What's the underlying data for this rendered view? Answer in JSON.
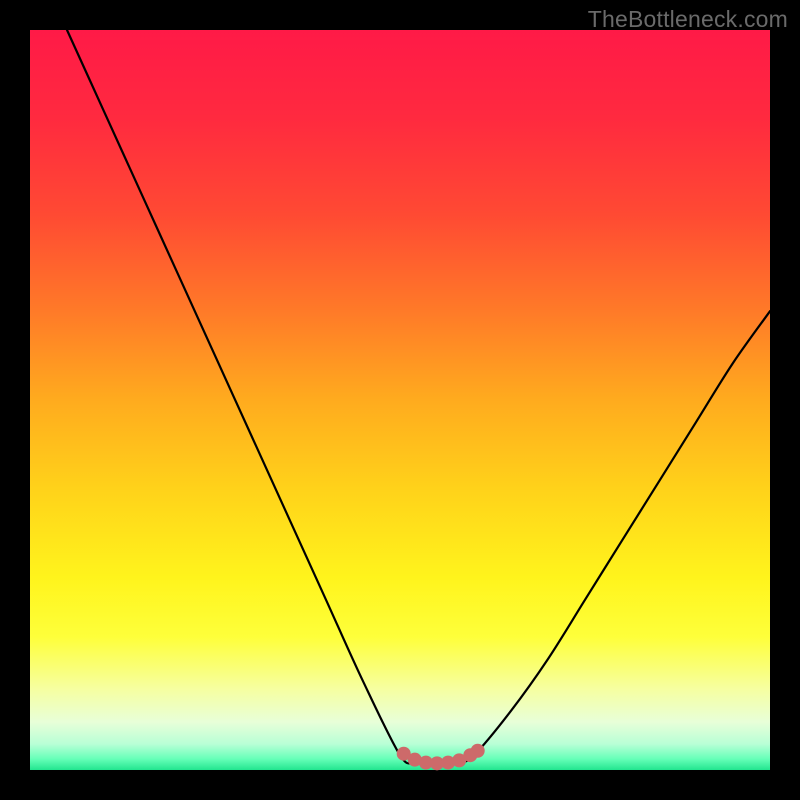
{
  "watermark": "TheBottleneck.com",
  "colors": {
    "frame": "#000000",
    "curve_stroke": "#000000",
    "marker_fill": "#cd6a6a",
    "gradient_stops": [
      {
        "offset": 0.0,
        "color": "#ff1a47"
      },
      {
        "offset": 0.12,
        "color": "#ff2a3f"
      },
      {
        "offset": 0.25,
        "color": "#ff4a33"
      },
      {
        "offset": 0.38,
        "color": "#ff7a28"
      },
      {
        "offset": 0.5,
        "color": "#ffab1e"
      },
      {
        "offset": 0.62,
        "color": "#ffd21a"
      },
      {
        "offset": 0.74,
        "color": "#fff41c"
      },
      {
        "offset": 0.82,
        "color": "#feff3a"
      },
      {
        "offset": 0.89,
        "color": "#f6ffa0"
      },
      {
        "offset": 0.935,
        "color": "#e8ffd8"
      },
      {
        "offset": 0.965,
        "color": "#b8ffd6"
      },
      {
        "offset": 0.985,
        "color": "#66ffb8"
      },
      {
        "offset": 1.0,
        "color": "#22e58f"
      }
    ]
  },
  "chart_data": {
    "type": "line",
    "title": "",
    "xlabel": "",
    "ylabel": "",
    "xlim": [
      0,
      100
    ],
    "ylim": [
      0,
      100
    ],
    "series": [
      {
        "name": "bottleneck-curve",
        "x": [
          5,
          10,
          15,
          20,
          25,
          30,
          35,
          40,
          45,
          50,
          52,
          54,
          56,
          58,
          60,
          65,
          70,
          75,
          80,
          85,
          90,
          95,
          100
        ],
        "y": [
          100,
          89,
          78,
          67,
          56,
          45,
          34,
          23,
          12,
          2,
          1,
          0.8,
          0.8,
          1,
          2,
          8,
          15,
          23,
          31,
          39,
          47,
          55,
          62
        ]
      }
    ],
    "markers": {
      "name": "bottom-markers",
      "points": [
        {
          "x": 50.5,
          "y": 2.2
        },
        {
          "x": 52.0,
          "y": 1.4
        },
        {
          "x": 53.5,
          "y": 1.0
        },
        {
          "x": 55.0,
          "y": 0.9
        },
        {
          "x": 56.5,
          "y": 1.0
        },
        {
          "x": 58.0,
          "y": 1.3
        },
        {
          "x": 59.5,
          "y": 2.0
        },
        {
          "x": 60.5,
          "y": 2.6
        }
      ],
      "radius": 7
    }
  }
}
